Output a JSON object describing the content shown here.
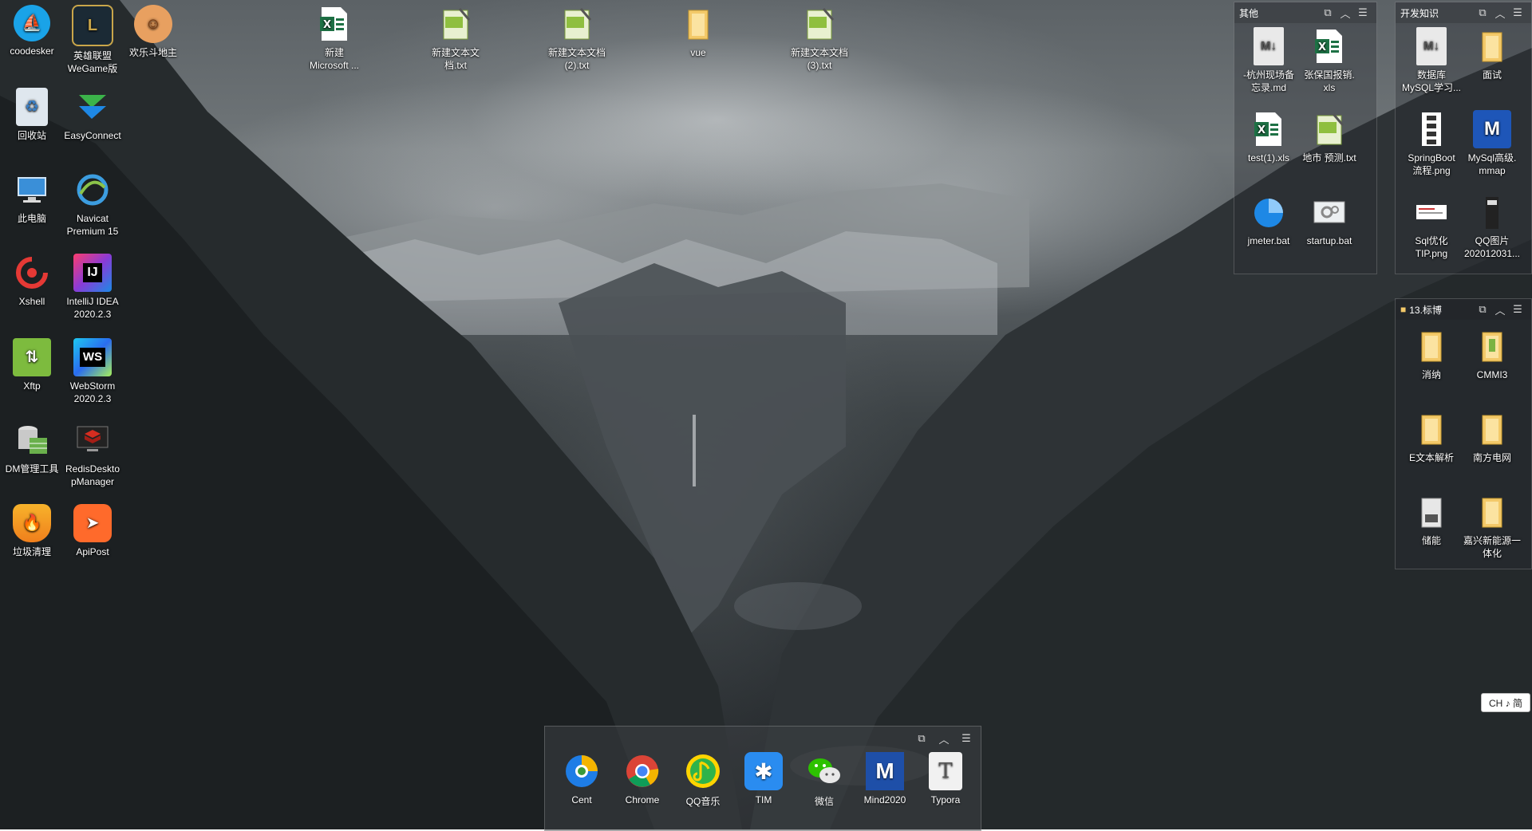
{
  "desktop_left": [
    {
      "label": "coodesker",
      "icon": "coodesker-icon"
    },
    {
      "label": "英雄联盟\nWeGame版",
      "icon": "lol-icon"
    },
    {
      "label": "欢乐斗地主",
      "icon": "doudizhu-icon"
    },
    {
      "label": "回收站",
      "icon": "recycle-bin-icon"
    },
    {
      "label": "EasyConnect",
      "icon": "easyconnect-icon"
    },
    {
      "label": "此电脑",
      "icon": "computer-icon"
    },
    {
      "label": "Navicat\nPremium 15",
      "icon": "navicat-icon"
    },
    {
      "label": "Xshell",
      "icon": "xshell-icon"
    },
    {
      "label": "IntelliJ IDEA\n2020.2.3",
      "icon": "intellij-icon"
    },
    {
      "label": "Xftp",
      "icon": "xftp-icon"
    },
    {
      "label": "WebStorm\n2020.2.3",
      "icon": "webstorm-icon"
    },
    {
      "label": "DM管理工具",
      "icon": "dm-tool-icon"
    },
    {
      "label": "RedisDeskto\npManager",
      "icon": "redis-desktop-icon"
    },
    {
      "label": "垃圾清理",
      "icon": "cleaner-icon"
    },
    {
      "label": "ApiPost",
      "icon": "apipost-icon"
    }
  ],
  "desktop_top": [
    {
      "label": "新建\nMicrosoft ...",
      "icon": "excel-file-icon"
    },
    {
      "label": "新建文本文\n档.txt",
      "icon": "txt-file-icon"
    },
    {
      "label": "新建文本文档\n(2).txt",
      "icon": "txt-file-icon"
    },
    {
      "label": "vue",
      "icon": "folder-icon"
    },
    {
      "label": "新建文本文档\n(3).txt",
      "icon": "txt-file-icon"
    }
  ],
  "fences": {
    "other": {
      "title": "其他",
      "items": [
        {
          "label": "-杭州现场备\n忘录.md",
          "icon": "markdown-file-icon"
        },
        {
          "label": "张保国报销.\nxls",
          "icon": "excel-file-icon"
        },
        {
          "label": "test(1).xls",
          "icon": "excel-file-icon"
        },
        {
          "label": "地市 预测.txt",
          "icon": "txt-file-icon"
        },
        {
          "label": "jmeter.bat",
          "icon": "jmeter-icon"
        },
        {
          "label": "startup.bat",
          "icon": "bat-file-icon"
        }
      ]
    },
    "dev": {
      "title": "开发知识",
      "items": [
        {
          "label": "数据库\nMySQL学习...",
          "icon": "markdown-file-icon"
        },
        {
          "label": "面试",
          "icon": "folder-icon"
        },
        {
          "label": "SpringBoot\n流程.png",
          "icon": "image-file-icon"
        },
        {
          "label": "MySql高级.\nmmap",
          "icon": "mindmap-file-icon"
        },
        {
          "label": "Sql优化\nTIP.png",
          "icon": "image-file-icon"
        },
        {
          "label": "QQ图片\n202012031...",
          "icon": "image-file-icon"
        }
      ]
    },
    "biaobo": {
      "title": "13.标博",
      "items": [
        {
          "label": "消纳",
          "icon": "folder-icon"
        },
        {
          "label": "CMMI3",
          "icon": "folder-icon"
        },
        {
          "label": "E文本解析",
          "icon": "folder-icon"
        },
        {
          "label": "南方电网",
          "icon": "folder-icon"
        },
        {
          "label": "储能",
          "icon": "archive-folder-icon"
        },
        {
          "label": "嘉兴新能源一\n体化",
          "icon": "folder-icon"
        }
      ]
    }
  },
  "dock": {
    "items": [
      {
        "label": "Cent",
        "icon": "cent-browser-icon"
      },
      {
        "label": "Chrome",
        "icon": "chrome-icon"
      },
      {
        "label": "QQ音乐",
        "icon": "qq-music-icon"
      },
      {
        "label": "TIM",
        "icon": "tim-icon"
      },
      {
        "label": "微信",
        "icon": "wechat-icon"
      },
      {
        "label": "Mind2020",
        "icon": "mindmanager-icon"
      },
      {
        "label": "Typora",
        "icon": "typora-icon"
      }
    ]
  },
  "fence_buttons": {
    "restore": "⧉",
    "collapse": "︿",
    "menu": "☰"
  },
  "ime": {
    "text": "CH ♪ 简"
  }
}
